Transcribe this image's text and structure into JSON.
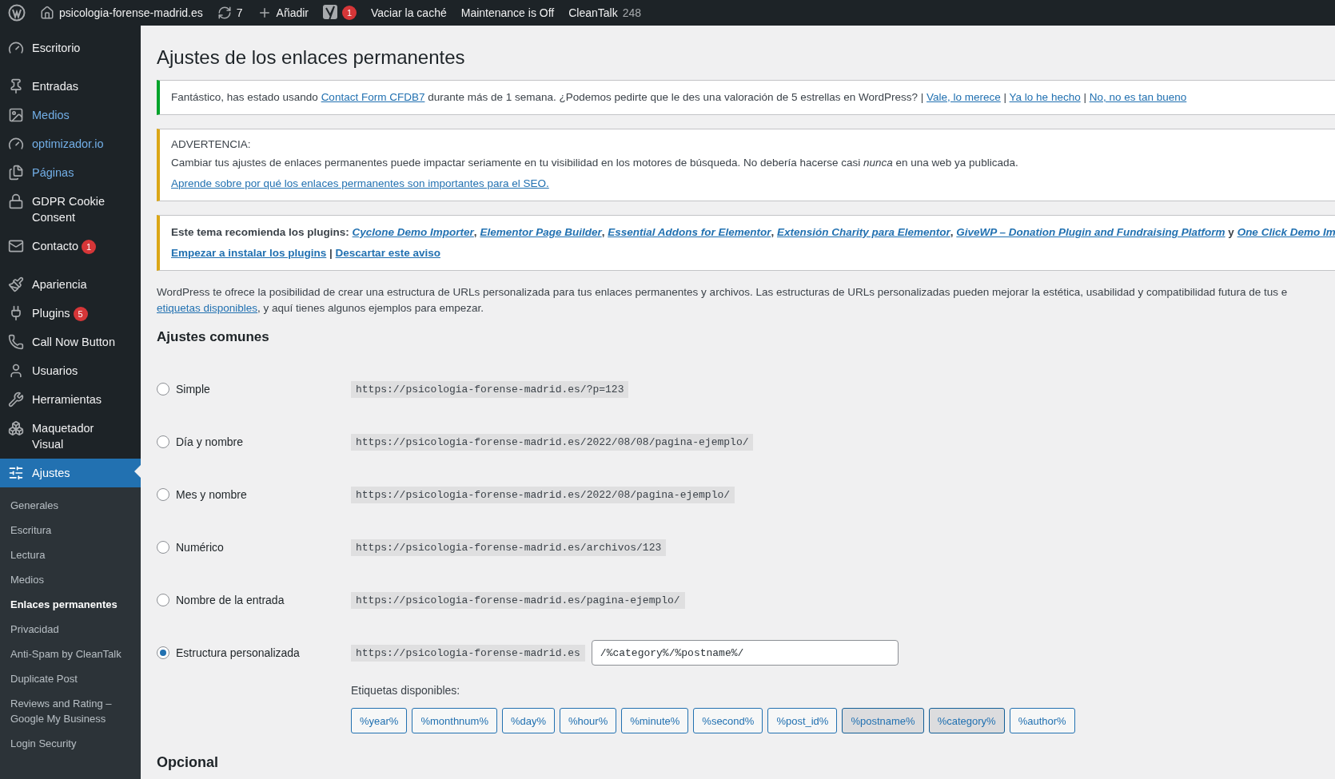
{
  "admin_bar": {
    "site": "psicologia-forense-madrid.es",
    "updates": "7",
    "add": "Añadir",
    "yoast_badge": "1",
    "links": [
      "Vaciar la caché",
      "Maintenance is Off"
    ],
    "cleantalk": {
      "label": "CleanTalk",
      "count": "248"
    }
  },
  "sidebar": {
    "items": [
      {
        "kind": "item",
        "label": "Escritorio",
        "highlighted": false,
        "selected": false
      },
      {
        "kind": "separator"
      },
      {
        "kind": "item",
        "label": "Entradas",
        "highlighted": false,
        "selected": false
      },
      {
        "kind": "item",
        "label": "Medios",
        "highlighted": true,
        "selected": false
      },
      {
        "kind": "item",
        "label": "optimizador.io",
        "highlighted": true,
        "selected": false
      },
      {
        "kind": "item",
        "label": "Páginas",
        "highlighted": true,
        "selected": false
      },
      {
        "kind": "item",
        "label": "GDPR Cookie Consent",
        "highlighted": false,
        "selected": false
      },
      {
        "kind": "item",
        "label": "Contacto",
        "highlighted": false,
        "selected": false,
        "badge": "1"
      },
      {
        "kind": "separator"
      },
      {
        "kind": "item",
        "label": "Apariencia",
        "highlighted": false,
        "selected": false
      },
      {
        "kind": "item",
        "label": "Plugins",
        "highlighted": false,
        "selected": false,
        "badge": "5"
      },
      {
        "kind": "item",
        "label": "Call Now Button",
        "highlighted": false,
        "selected": false
      },
      {
        "kind": "item",
        "label": "Usuarios",
        "highlighted": false,
        "selected": false
      },
      {
        "kind": "item",
        "label": "Herramientas",
        "highlighted": false,
        "selected": false
      },
      {
        "kind": "item",
        "label": "Maquetador Visual",
        "highlighted": false,
        "selected": false
      },
      {
        "kind": "item",
        "label": "Ajustes",
        "highlighted": false,
        "selected": true
      }
    ],
    "submenu": [
      {
        "label": "Generales",
        "selected": false
      },
      {
        "label": "Escritura",
        "selected": false
      },
      {
        "label": "Lectura",
        "selected": false
      },
      {
        "label": "Medios",
        "selected": false
      },
      {
        "label": "Enlaces permanentes",
        "selected": true
      },
      {
        "label": "Privacidad",
        "selected": false
      },
      {
        "label": "Anti-Spam by CleanTalk",
        "selected": false
      },
      {
        "label": "Duplicate Post",
        "selected": false
      },
      {
        "label": "Reviews and Rating – Google My Business",
        "selected": false
      },
      {
        "label": "Login Security",
        "selected": false
      }
    ]
  },
  "title": "Ajustes de los enlaces permanentes",
  "notices": [
    {
      "kind": "success",
      "lines": [
        [
          {
            "kind": "text",
            "text": "Fantástico, has estado usando "
          },
          {
            "kind": "link",
            "text": "Contact Form CFDB7"
          },
          {
            "kind": "text",
            "text": " durante más de 1 semana. ¿Podemos pedirte que le des una valoración de 5 estrellas en WordPress? | "
          },
          {
            "kind": "link",
            "text": "Vale, lo merece"
          },
          {
            "kind": "text",
            "text": " | "
          },
          {
            "kind": "link",
            "text": "Ya lo he hecho"
          },
          {
            "kind": "text",
            "text": " | "
          },
          {
            "kind": "link",
            "text": "No, no es tan bueno"
          }
        ]
      ]
    },
    {
      "kind": "warning",
      "heading": "ADVERTENCIA:",
      "lines": [
        [
          {
            "kind": "text",
            "text": "Cambiar tus ajustes de enlaces permanentes puede impactar seriamente en tu visibilidad en los motores de búsqueda. No debería hacerse casi *nunca* en una web ya publicada."
          }
        ],
        [
          {
            "kind": "link",
            "text": "Aprende sobre por qué los enlaces permanentes son importantes para el SEO."
          }
        ]
      ]
    },
    {
      "kind": "warning",
      "bold": true,
      "lines": [
        [
          {
            "kind": "text",
            "text": "Este tema recomienda los plugins: "
          },
          {
            "kind": "plugin",
            "text": "Cyclone Demo Importer"
          },
          {
            "kind": "text",
            "text": ", "
          },
          {
            "kind": "plugin",
            "text": "Elementor Page Builder"
          },
          {
            "kind": "text",
            "text": ", "
          },
          {
            "kind": "plugin",
            "text": "Essential Addons for Elementor"
          },
          {
            "kind": "text",
            "text": ", "
          },
          {
            "kind": "plugin",
            "text": "Extensión Charity para Elementor"
          },
          {
            "kind": "text",
            "text": ", "
          },
          {
            "kind": "plugin",
            "text": "GiveWP – Donation Plugin and Fundraising Platform"
          },
          {
            "kind": "text",
            "text": " y "
          },
          {
            "kind": "plugin",
            "text": "One Click Demo Im"
          }
        ],
        [
          {
            "kind": "link",
            "text": "Empezar a instalar los plugins"
          },
          {
            "kind": "text",
            "text": " | "
          },
          {
            "kind": "link",
            "text": "Descartar este aviso"
          }
        ]
      ]
    }
  ],
  "intro": [
    [
      {
        "kind": "text",
        "text": "WordPress te ofrece la posibilidad de crear una estructura de URLs personalizada para tus enlaces permanentes y archivos. Las estructuras de URLs personalizadas pueden mejorar la estética, usabilidad y compatibilidad futura de tus e"
      }
    ],
    [
      {
        "kind": "link",
        "text": "etiquetas disponibles"
      },
      {
        "kind": "text",
        "text": ", y aquí tienes algunos ejemplos para empezar."
      }
    ]
  ],
  "section_title": "Ajustes comunes",
  "options": [
    {
      "kind": "preset",
      "label": "Simple",
      "example": "https://psicologia-forense-madrid.es/?p=123",
      "selected": false
    },
    {
      "kind": "preset",
      "label": "Día y nombre",
      "example": "https://psicologia-forense-madrid.es/2022/08/08/pagina-ejemplo/",
      "selected": false
    },
    {
      "kind": "preset",
      "label": "Mes y nombre",
      "example": "https://psicologia-forense-madrid.es/2022/08/pagina-ejemplo/",
      "selected": false
    },
    {
      "kind": "preset",
      "label": "Numérico",
      "example": "https://psicologia-forense-madrid.es/archivos/123",
      "selected": false
    },
    {
      "kind": "preset",
      "label": "Nombre de la entrada",
      "example": "https://psicologia-forense-madrid.es/pagina-ejemplo/",
      "selected": false
    },
    {
      "kind": "custom",
      "label": "Estructura personalizada",
      "example": "https://psicologia-forense-madrid.es",
      "value": "/%category%/%postname%/",
      "selected": true
    }
  ],
  "tags_label": "Etiquetas disponibles:",
  "tags": [
    {
      "label": "%year%",
      "selected": false
    },
    {
      "label": "%monthnum%",
      "selected": false
    },
    {
      "label": "%day%",
      "selected": false
    },
    {
      "label": "%hour%",
      "selected": false
    },
    {
      "label": "%minute%",
      "selected": false
    },
    {
      "label": "%second%",
      "selected": false
    },
    {
      "label": "%post_id%",
      "selected": false
    },
    {
      "label": "%postname%",
      "selected": true
    },
    {
      "label": "%category%",
      "selected": true
    },
    {
      "label": "%author%",
      "selected": false
    }
  ],
  "optional_title": "Opcional"
}
